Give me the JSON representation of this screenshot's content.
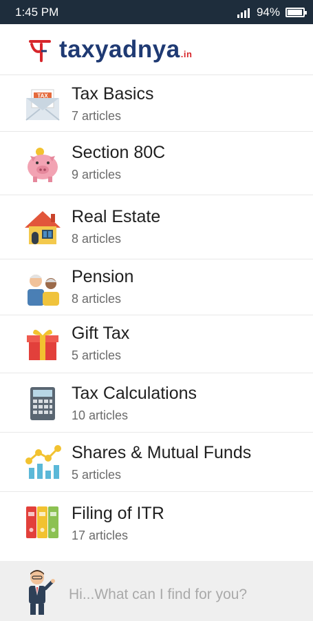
{
  "status": {
    "time": "1:45 PM",
    "battery": "94%"
  },
  "header": {
    "logo_glyph": "य",
    "logo_tax": "tax",
    "logo_yadnya": "yadnya",
    "logo_suffix": ".in"
  },
  "categories": [
    {
      "title": "Tax Basics",
      "count": "7 articles",
      "icon": "tax-envelope-icon"
    },
    {
      "title": "Section 80C",
      "count": "9 articles",
      "icon": "piggy-bank-icon"
    },
    {
      "title": "Real Estate",
      "count": "8 articles",
      "icon": "house-icon"
    },
    {
      "title": "Pension",
      "count": "8 articles",
      "icon": "elderly-couple-icon"
    },
    {
      "title": "Gift Tax",
      "count": "5 articles",
      "icon": "gift-box-icon"
    },
    {
      "title": "Tax Calculations",
      "count": "10 articles",
      "icon": "calculator-icon"
    },
    {
      "title": "Shares & Mutual Funds",
      "count": "5 articles",
      "icon": "bar-chart-icon"
    },
    {
      "title": "Filing of ITR",
      "count": "17 articles",
      "icon": "binders-icon"
    }
  ],
  "assistant": {
    "prompt": "Hi...What can I find for you?"
  },
  "colors": {
    "status_bar": "#1e2d3c",
    "logo_blue": "#1f3a73",
    "logo_red": "#d7262b"
  }
}
